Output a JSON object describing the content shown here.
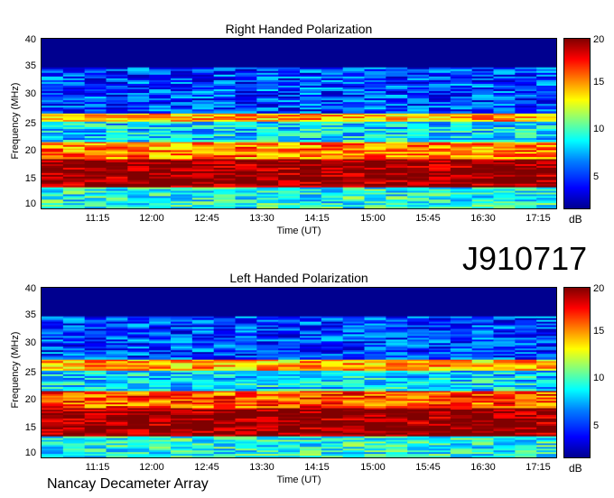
{
  "chart_data": [
    {
      "type": "heatmap",
      "title": "Right Handed Polarization",
      "xlabel": "Time (UT)",
      "ylabel": "Frequency (MHz)",
      "x_ticks": [
        "11:15",
        "12:00",
        "12:45",
        "13:30",
        "14:15",
        "15:00",
        "15:45",
        "16:30",
        "17:15"
      ],
      "y_ticks": [
        10,
        15,
        20,
        25,
        30,
        35,
        40
      ],
      "ylim": [
        10,
        40
      ],
      "colorbar": {
        "label": "dB",
        "ticks": [
          5,
          10,
          15,
          20
        ],
        "range": [
          1,
          20
        ]
      },
      "bands": [
        {
          "freq_range": [
            14,
            19
          ],
          "level": 20
        },
        {
          "freq_range": [
            19,
            22
          ],
          "level": 15
        },
        {
          "freq_range": [
            25.5,
            27
          ],
          "level": 14
        },
        {
          "freq_range": [
            22,
            25.5
          ],
          "level": 7
        },
        {
          "freq_range": [
            27,
            35
          ],
          "level": 4
        },
        {
          "freq_range": [
            10,
            14
          ],
          "level": 8
        }
      ]
    },
    {
      "type": "heatmap",
      "title": "Left Handed Polarization",
      "xlabel": "Time (UT)",
      "ylabel": "Frequency (MHz)",
      "x_ticks": [
        "11:15",
        "12:00",
        "12:45",
        "13:30",
        "14:15",
        "15:00",
        "15:45",
        "16:30",
        "17:15"
      ],
      "y_ticks": [
        10,
        15,
        20,
        25,
        30,
        35,
        40
      ],
      "ylim": [
        10,
        40
      ],
      "colorbar": {
        "label": "dB",
        "ticks": [
          5,
          10,
          15,
          20
        ],
        "range": [
          1,
          20
        ]
      },
      "bands": [
        {
          "freq_range": [
            14,
            19
          ],
          "level": 20
        },
        {
          "freq_range": [
            19,
            22
          ],
          "level": 16
        },
        {
          "freq_range": [
            25.5,
            27.5
          ],
          "level": 14
        },
        {
          "freq_range": [
            22,
            25.5
          ],
          "level": 7
        },
        {
          "freq_range": [
            27.5,
            35
          ],
          "level": 4
        },
        {
          "freq_range": [
            10,
            14
          ],
          "level": 8
        }
      ]
    }
  ],
  "stamp": "J910717",
  "footer": "Nancay Decameter Array"
}
